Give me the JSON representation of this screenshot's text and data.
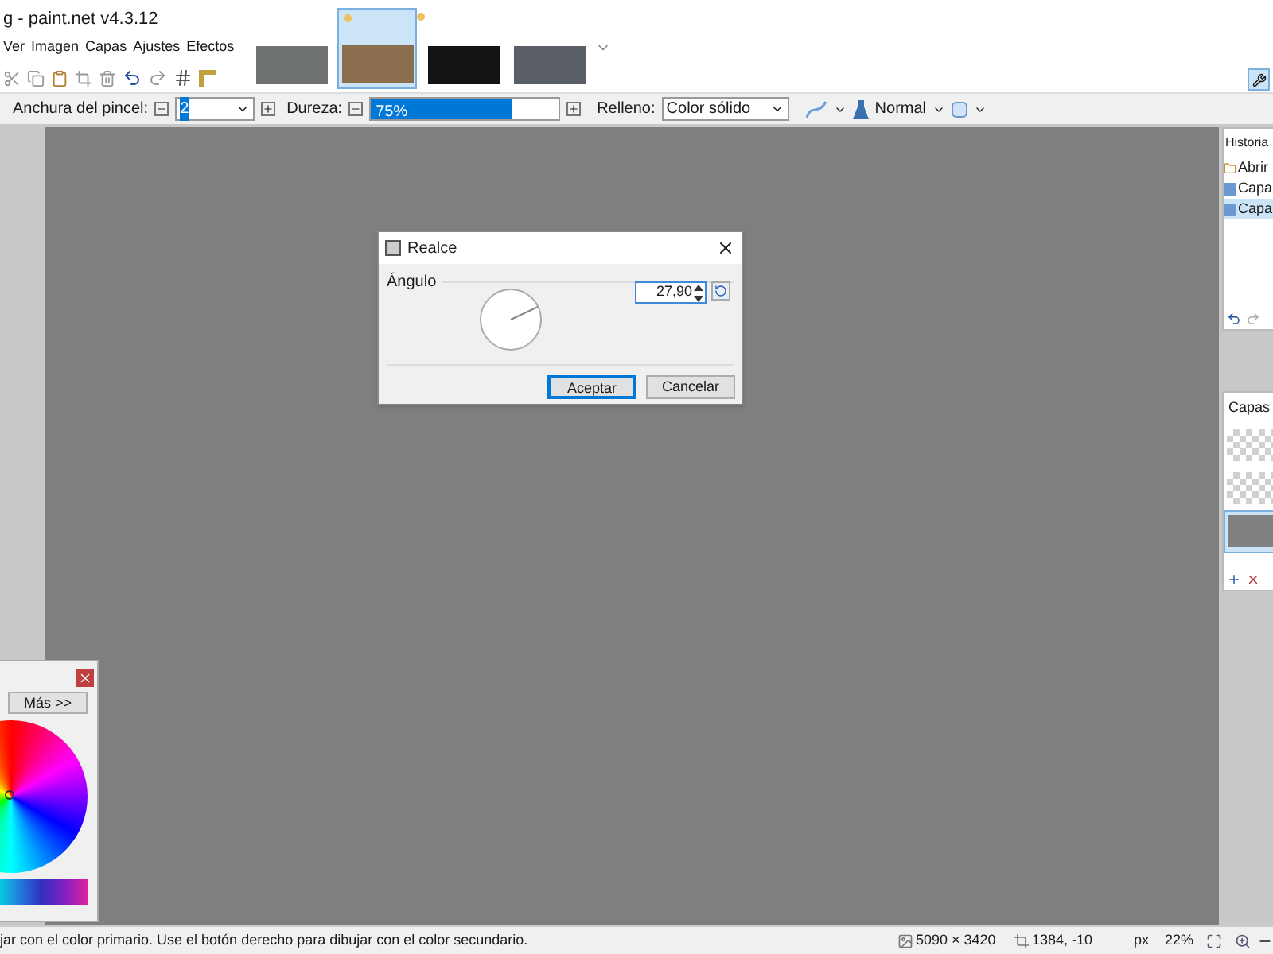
{
  "window": {
    "title": "g - paint.net v4.3.12"
  },
  "menu": [
    "Ver",
    "Imagen",
    "Capas",
    "Ajustes",
    "Efectos"
  ],
  "images": [
    {
      "selected": false,
      "color": "#6e7270",
      "unsaved": false
    },
    {
      "selected": true,
      "color": "#8a6e4e",
      "unsaved": true
    },
    {
      "selected": false,
      "color": "#141414",
      "unsaved": true
    },
    {
      "selected": false,
      "color": "#5a5e66",
      "unsaved": false
    }
  ],
  "tool_options": {
    "brush_label": "Anchura del pincel:",
    "brush_value": "2",
    "hardness_label": "Dureza:",
    "hardness": {
      "reading": "75%",
      "level": 0.75
    },
    "fill_label": "Relleno:",
    "fill_value": "Color sólido",
    "blend_mode": "Normal"
  },
  "dialog": {
    "title": "Realce",
    "section": "Ángulo",
    "angle_value": "27,90",
    "buttons": [
      {
        "label": "Aceptar",
        "selected": true
      },
      {
        "label": "Cancelar",
        "selected": false
      }
    ]
  },
  "history": {
    "title": "Historia",
    "items": [
      {
        "label": "Abrir",
        "selected": false
      },
      {
        "label": "Capa",
        "selected": false
      },
      {
        "label": "Capa",
        "selected": true
      }
    ]
  },
  "layers": {
    "title": "Capas",
    "items": [
      {
        "kind": "transparent",
        "selected": false
      },
      {
        "kind": "transparent",
        "selected": false
      },
      {
        "kind": "filled",
        "selected": true
      }
    ]
  },
  "colors": {
    "more_button": "Más >>"
  },
  "status_bar": {
    "hint": "jar con el color primario. Use el botón derecho para dibujar con el color secundario.",
    "image_size": "5090 × 3420",
    "cursor": "1384, -10",
    "unit": "px",
    "zoom": "22%"
  }
}
